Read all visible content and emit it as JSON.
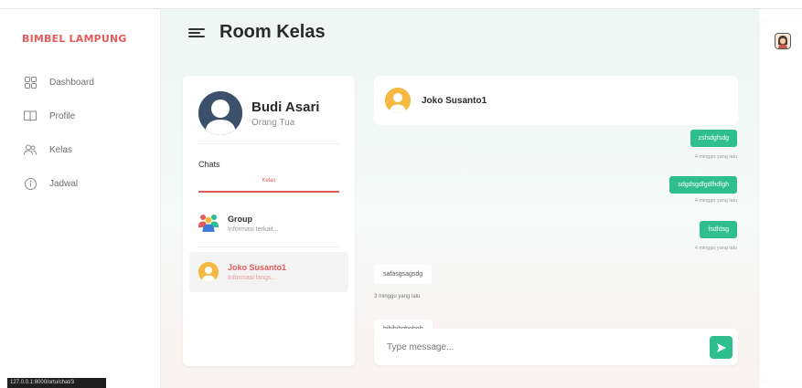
{
  "sidebar": {
    "brand": "BIMBEL LAMPUNG",
    "items": [
      {
        "label": "Dashboard",
        "icon": "grid-icon"
      },
      {
        "label": "Profile",
        "icon": "book-icon"
      },
      {
        "label": "Kelas",
        "icon": "users-icon"
      },
      {
        "label": "Jadwal",
        "icon": "info-icon"
      }
    ]
  },
  "status_url": "127.0.0.1:8000/ortu/chat/3",
  "header": {
    "title": "Room Kelas"
  },
  "profile": {
    "name": "Budi Asari",
    "role": "Orang Tua"
  },
  "chats": {
    "label": "Chats",
    "tab": "Kelas",
    "items": [
      {
        "name": "Group",
        "preview": "Informasi terkait..."
      },
      {
        "name": "Joko Susanto1",
        "preview": "Informasi langs..."
      }
    ]
  },
  "conversation": {
    "contact": "Joko Susanto1",
    "messages": [
      {
        "text": "zsfsdgfsdg",
        "time": "4 minggu yang lalu",
        "direction": "out"
      },
      {
        "text": "sdgdsgdfgdfhdfgh",
        "time": "4 minggu yang lalu",
        "direction": "out"
      },
      {
        "text": "fsdfdsg",
        "time": "4 minggu yang lalu",
        "direction": "out"
      },
      {
        "text": "safasgsagsdg",
        "time": "3 minggu yang lalu",
        "direction": "in"
      },
      {
        "text": "hjhjhjhghghgh",
        "time": "",
        "direction": "in"
      }
    ],
    "input_placeholder": "Type message..."
  },
  "colors": {
    "accent": "#e35b5b",
    "green": "#2fbf8f"
  }
}
